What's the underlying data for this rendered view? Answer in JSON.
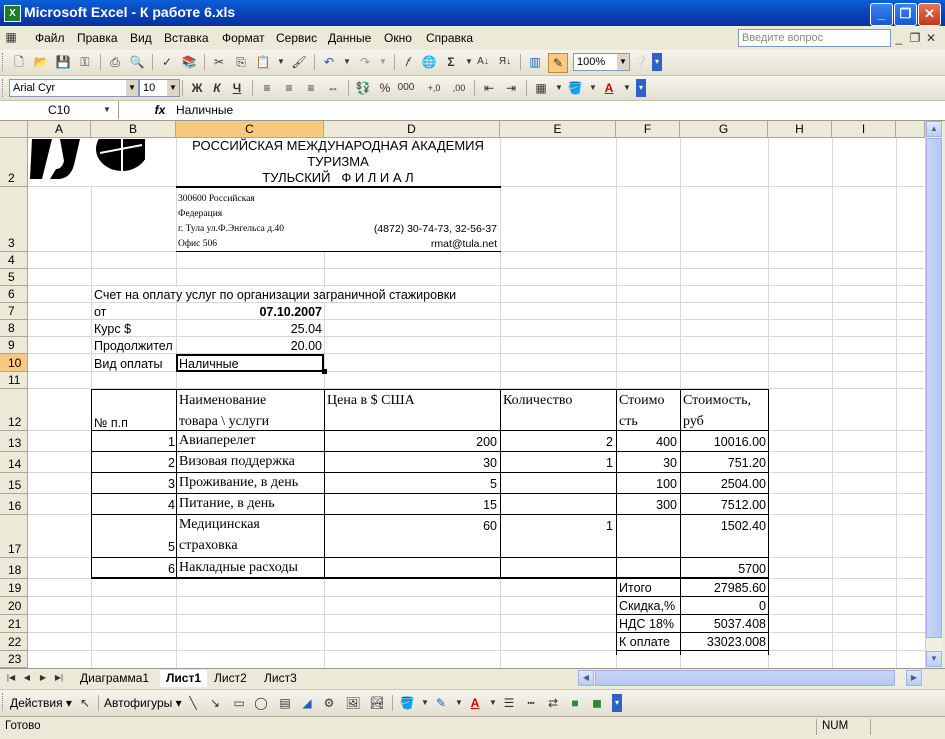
{
  "window": {
    "title": "Microsoft Excel - К работе 6.xls",
    "app_icon": "excel-icon"
  },
  "menu": {
    "items": [
      "Файл",
      "Правка",
      "Вид",
      "Вставка",
      "Формат",
      "Сервис",
      "Данные",
      "Окно",
      "Справка"
    ],
    "help_placeholder": "Введите вопрос"
  },
  "toolbar": {
    "zoom": "100%"
  },
  "format": {
    "font": "Arial Cyr",
    "size": "10",
    "bold": "Ж",
    "italic": "К",
    "underline": "Ч",
    "percent": "%",
    "thousands": "000",
    "inc_decimal": "+,0",
    "dec_decimal": ",00"
  },
  "formula": {
    "cell": "C10",
    "fx": "fx",
    "value": "Наличные"
  },
  "columns": [
    "A",
    "B",
    "C",
    "D",
    "E",
    "F",
    "G",
    "H",
    "I"
  ],
  "rows": [
    "2",
    "3",
    "4",
    "5",
    "6",
    "7",
    "8",
    "9",
    "10",
    "11",
    "12",
    "13",
    "14",
    "15",
    "16",
    "17",
    "18",
    "19",
    "20",
    "21",
    "22",
    "23"
  ],
  "header": {
    "line1": "РОССИЙСКАЯ МЕЖДУНАРОДНАЯ АКАДЕМИЯ",
    "line2": "ТУРИЗМА",
    "line3": "ТУЛЬСКИЙ   Ф И Л И А Л",
    "addr1": "300600 Российская",
    "addr2": "Федерация",
    "addr3": "г. Тула  ул.Ф.Энгельса д.40",
    "addr4": "Офис 506",
    "phone": "(4872) 30-74-73, 32-56-37",
    "email": "rmat@tula.net"
  },
  "invoice": {
    "title": "Счет на оплату услуг по организации заграничной стажировки",
    "from_label": "от",
    "date": "07.10.2007",
    "rate_label": "Курс $",
    "rate": "25.04",
    "duration_label": "Продолжител",
    "duration": "20.00",
    "payment_label": "Вид оплаты",
    "payment": "Наличные"
  },
  "table": {
    "h_num": "№ п.п",
    "h_name1": "Наименование",
    "h_name2": "товара \\ услуги",
    "h_price": "Цена в $ США",
    "h_qty": "Количество",
    "h_cost1": "Стоимо",
    "h_cost2": "сть",
    "h_rub1": "Стоимость,",
    "h_rub2": "руб",
    "rows": [
      {
        "n": "1",
        "name": "Авиаперелет",
        "price": "200",
        "qty": "2",
        "cost": "400",
        "rub": "10016.00"
      },
      {
        "n": "2",
        "name": "Визовая поддержка",
        "price": "30",
        "qty": "1",
        "cost": "30",
        "rub": "751.20"
      },
      {
        "n": "3",
        "name": "Проживание, в день",
        "price": "5",
        "qty": "",
        "cost": "100",
        "rub": "2504.00"
      },
      {
        "n": "4",
        "name": "Питание, в день",
        "price": "15",
        "qty": "",
        "cost": "300",
        "rub": "7512.00"
      },
      {
        "n": "5",
        "name1": "Медицинская",
        "name2": "страховка",
        "price": "60",
        "qty": "1",
        "cost": "",
        "rub": "1502.40"
      },
      {
        "n": "6",
        "name": "Накладные расходы",
        "price": "",
        "qty": "",
        "cost": "",
        "rub": "5700"
      }
    ]
  },
  "totals": {
    "total_label": "Итого",
    "total": "27985.60",
    "discount_label": "Скидка,%",
    "discount": "0",
    "vat_label": "НДС 18%",
    "vat": "5037.408",
    "pay_label": "К оплате",
    "pay": "33023.008"
  },
  "sheets": [
    "Диаграмма1",
    "Лист1",
    "Лист2",
    "Лист3"
  ],
  "draw": {
    "actions": "Действия",
    "autoshapes": "Автофигуры"
  },
  "status": {
    "ready": "Готово",
    "num": "NUM"
  }
}
